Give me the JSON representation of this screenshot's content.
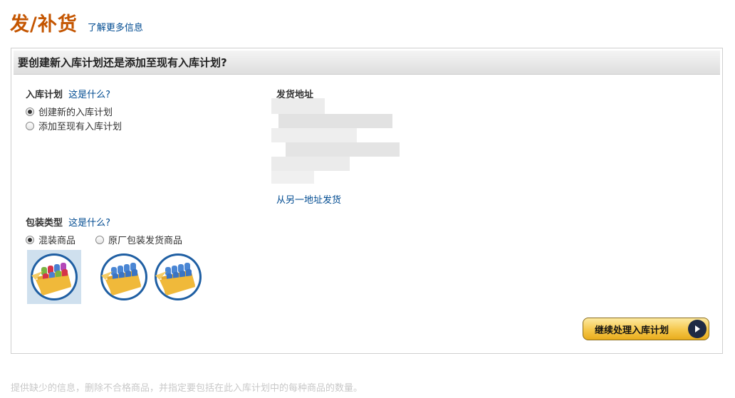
{
  "header": {
    "title": "发/补货",
    "learn_more": "了解更多信息"
  },
  "panel": {
    "title": "要创建新入库计划还是添加至现有入库计划?",
    "plan": {
      "label": "入库计划",
      "help": "这是什么?",
      "options": [
        {
          "label": "创建新的入库计划",
          "selected": true
        },
        {
          "label": "添加至现有入库计划",
          "selected": false
        }
      ]
    },
    "address": {
      "label": "发货地址",
      "alt_link": "从另一地址发货"
    },
    "packing": {
      "label": "包装类型",
      "help": "这是什么?",
      "options": [
        {
          "label": "混装商品",
          "selected": true
        },
        {
          "label": "原厂包装发货商品",
          "selected": false
        }
      ]
    },
    "continue_button": "继续处理入库计划"
  },
  "footer": {
    "note": "提供缺少的信息，删除不合格商品，并指定要包括在此入库计划中的每种商品的数量。"
  },
  "colors": {
    "title": "#c45500",
    "link": "#004b91",
    "button": "#f5c74a"
  }
}
